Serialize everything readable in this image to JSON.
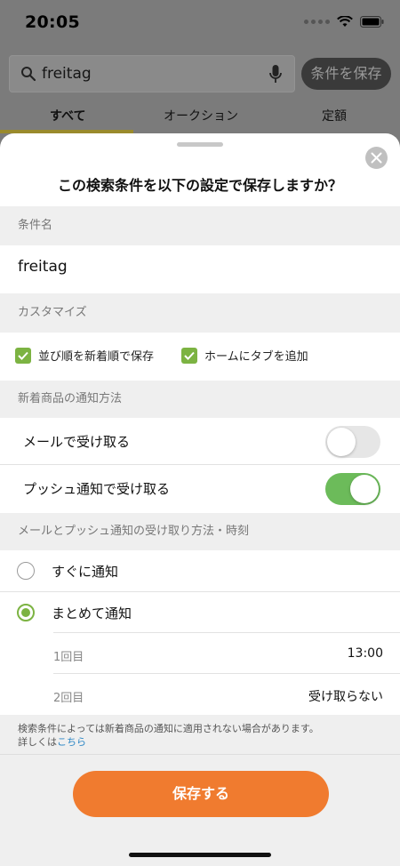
{
  "status_bar": {
    "time": "20:05"
  },
  "search": {
    "query": "freitag",
    "save_button": "条件を保存"
  },
  "tabs": [
    {
      "label": "すべて"
    },
    {
      "label": "オークション"
    },
    {
      "label": "定額"
    }
  ],
  "sheet": {
    "title": "この検索条件を以下の設定で保存しますか？",
    "name_section": {
      "header": "条件名",
      "value": "freitag"
    },
    "customize_section": {
      "header": "カスタマイズ",
      "options": [
        {
          "label": "並び順を新着順で保存",
          "checked": true
        },
        {
          "label": "ホームにタブを追加",
          "checked": true
        }
      ]
    },
    "notify_section": {
      "header": "新着商品の通知方法",
      "rows": [
        {
          "label": "メールで受け取る",
          "on": false
        },
        {
          "label": "プッシュ通知で受け取る",
          "on": true
        }
      ]
    },
    "timing_section": {
      "header": "メールとプッシュ通知の受け取り方法・時刻",
      "options": [
        {
          "label": "すぐに通知",
          "selected": false
        },
        {
          "label": "まとめて通知",
          "selected": true
        }
      ],
      "times": [
        {
          "label": "1回目",
          "value": "13:00"
        },
        {
          "label": "2回目",
          "value": "受け取らない"
        }
      ]
    },
    "note": {
      "text": "検索条件によっては新着商品の通知に適用されない場合があります。",
      "details_prefix": "詳しくは",
      "link": "こちら"
    },
    "save_button": "保存する"
  },
  "colors": {
    "accent_green": "#7cb342",
    "toggle_on": "#6cbb5a",
    "primary_orange": "#f07b2f",
    "link_blue": "#2b86c5"
  },
  "icons": [
    "wifi-icon",
    "battery-icon",
    "search-icon",
    "mic-icon",
    "close-icon",
    "check-icon"
  ]
}
